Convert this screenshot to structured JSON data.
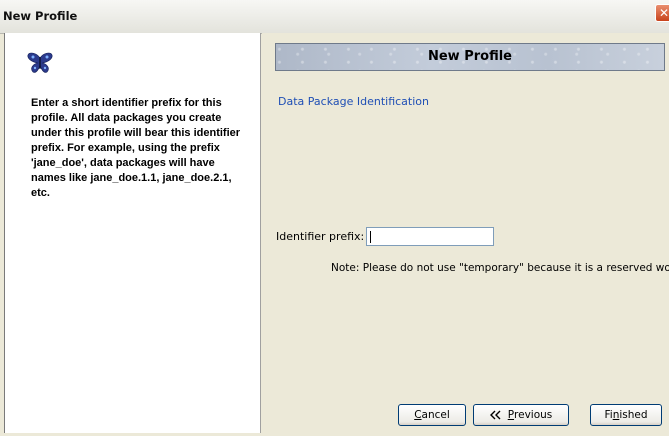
{
  "window": {
    "title": "New Profile",
    "close_glyph": "✕"
  },
  "left_panel": {
    "icon": "butterfly-icon",
    "description": "Enter a short identifier prefix for this profile. All data packages you create under this profile will bear this identifier prefix. For example, using the prefix 'jane_doe', data packages will have names like jane_doe.1.1, jane_doe.2.1, etc."
  },
  "banner": {
    "title": "New Profile"
  },
  "section": {
    "link": "Data Package Identification"
  },
  "form": {
    "identifier_label": "Identifier prefix:",
    "identifier_value": "",
    "note": "Note: Please do not use \"temporary\" because it is a reserved word."
  },
  "buttons": {
    "cancel": {
      "mnemonic": "C",
      "rest": "ancel"
    },
    "previous": {
      "icon": "double-chevron-left-icon",
      "mnemonic": "P",
      "rest": "revious"
    },
    "finished": {
      "before": "Fi",
      "mnemonic": "n",
      "rest": "ished"
    }
  },
  "colors": {
    "link": "#1f4fb5",
    "dialog_bg": "#ece9d8",
    "button_border": "#003c74"
  }
}
